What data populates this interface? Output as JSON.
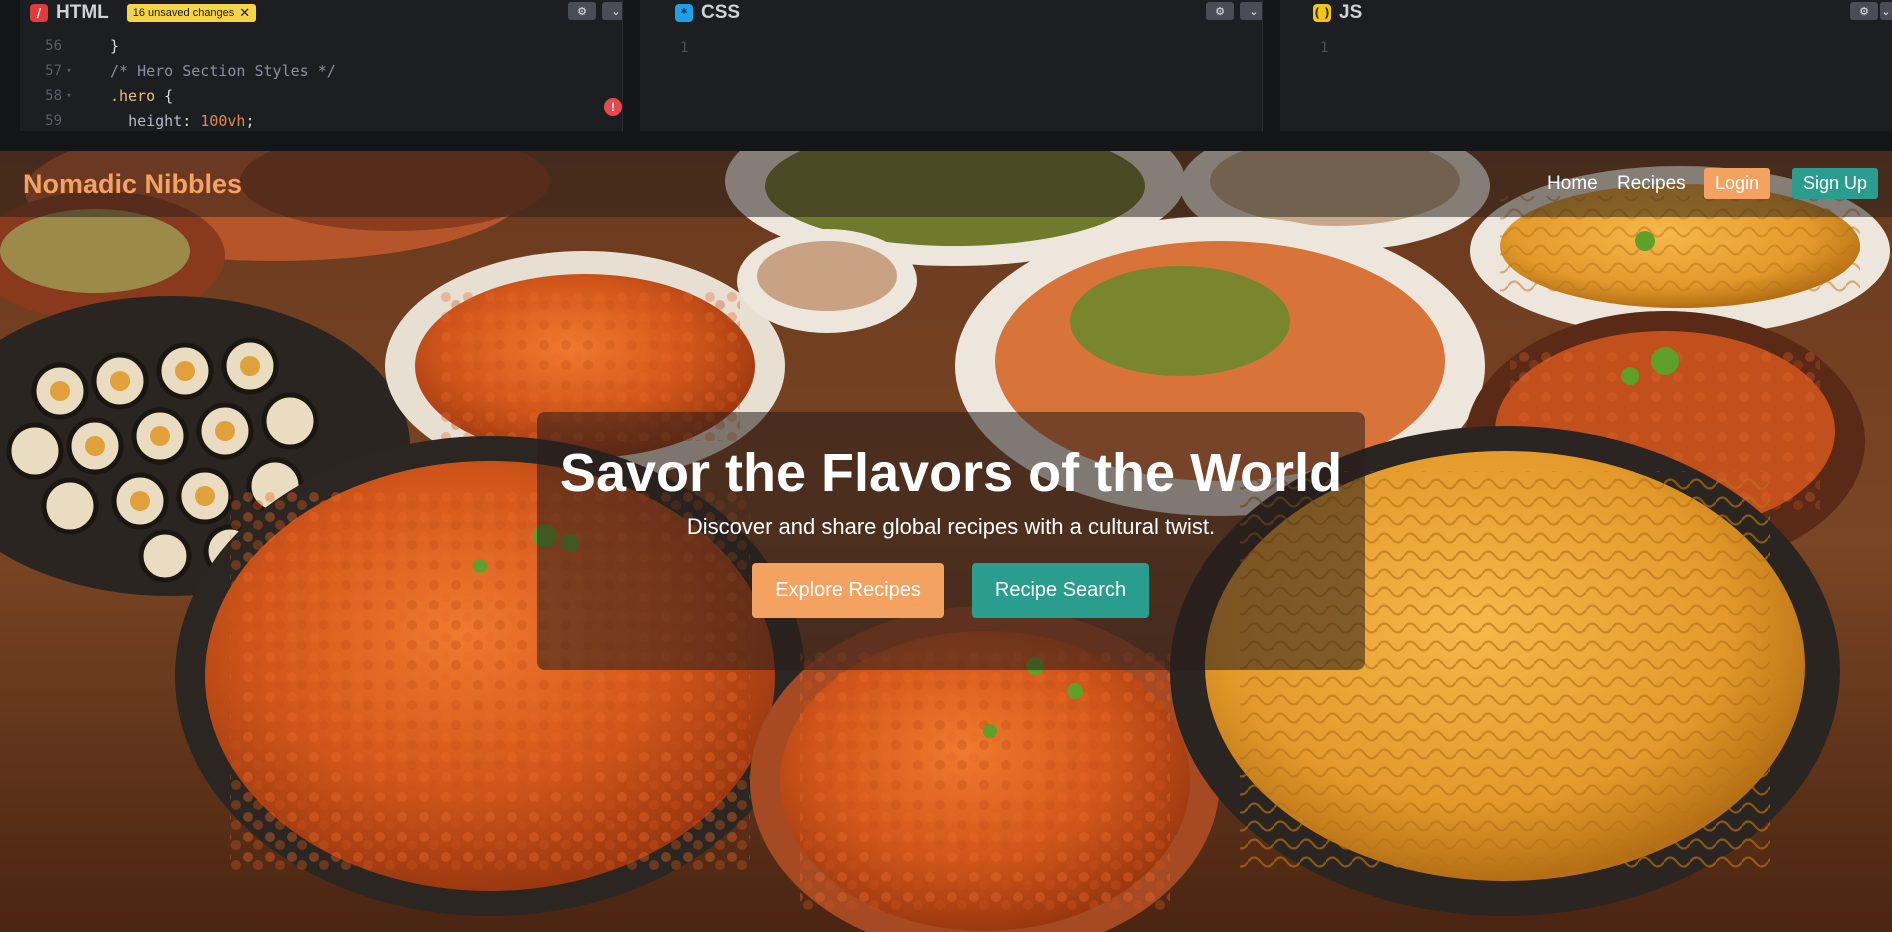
{
  "editor": {
    "html_panel": {
      "title": "HTML",
      "badge": "16 unsaved changes",
      "code_lines": [
        {
          "num": "56",
          "text": "}"
        },
        {
          "num": "57",
          "text": "/* Hero Section Styles */"
        },
        {
          "num": "58",
          "selector": ".hero",
          "brace": " {"
        },
        {
          "num": "59",
          "prop": "height",
          "value": "100vh"
        }
      ]
    },
    "css_panel": {
      "title": "CSS",
      "line": "1"
    },
    "js_panel": {
      "title": "JS",
      "line": "1"
    }
  },
  "site": {
    "brand": "Nomadic Nibbles",
    "nav": {
      "home": "Home",
      "recipes": "Recipes",
      "login": "Login",
      "signup": "Sign Up"
    },
    "hero": {
      "title": "Savor the Flavors of the World",
      "subtitle": "Discover and share global recipes with a cultural twist.",
      "explore_button": "Explore Recipes",
      "search_button": "Recipe Search"
    }
  },
  "colors": {
    "brand_orange": "#f4a261",
    "teal": "#2a9d8f",
    "editor_bg": "#1d1e22",
    "badge_yellow": "#f5d547"
  }
}
